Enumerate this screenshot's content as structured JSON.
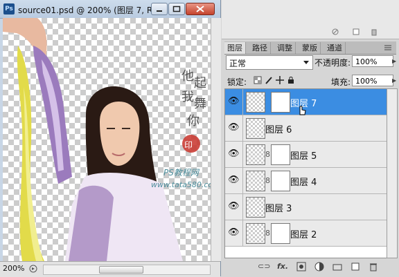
{
  "document": {
    "ps_icon": "Ps",
    "title": "source01.psd @ 200% (图层 7, R...",
    "zoom": "200%",
    "watermark_site": "PS教程网",
    "watermark_url": "www.tata580.com"
  },
  "panel": {
    "tabs": [
      "图层",
      "路径",
      "调整",
      "蒙版",
      "通道"
    ],
    "blend_mode": "正常",
    "opacity_label": "不透明度:",
    "opacity_value": "100%",
    "lock_label": "锁定:",
    "fill_label": "填充:",
    "fill_value": "100%",
    "layers": [
      {
        "name": "图层 7",
        "visible": true,
        "mask": true,
        "selected": true
      },
      {
        "name": "图层 6",
        "visible": true,
        "mask": false,
        "selected": false
      },
      {
        "name": "图层 5",
        "visible": true,
        "mask": true,
        "selected": false
      },
      {
        "name": "图层 4",
        "visible": true,
        "mask": true,
        "selected": false
      },
      {
        "name": "图层 3",
        "visible": true,
        "mask": false,
        "selected": false
      },
      {
        "name": "图层 2",
        "visible": true,
        "mask": true,
        "selected": false
      }
    ],
    "bottom_fx": "fx."
  },
  "icons": [
    "eye-icon",
    "chain-icon",
    "hand-cursor-icon",
    "lock-icon",
    "brush-icon",
    "move-icon",
    "trash-icon",
    "new-layer-icon",
    "folder-icon"
  ]
}
